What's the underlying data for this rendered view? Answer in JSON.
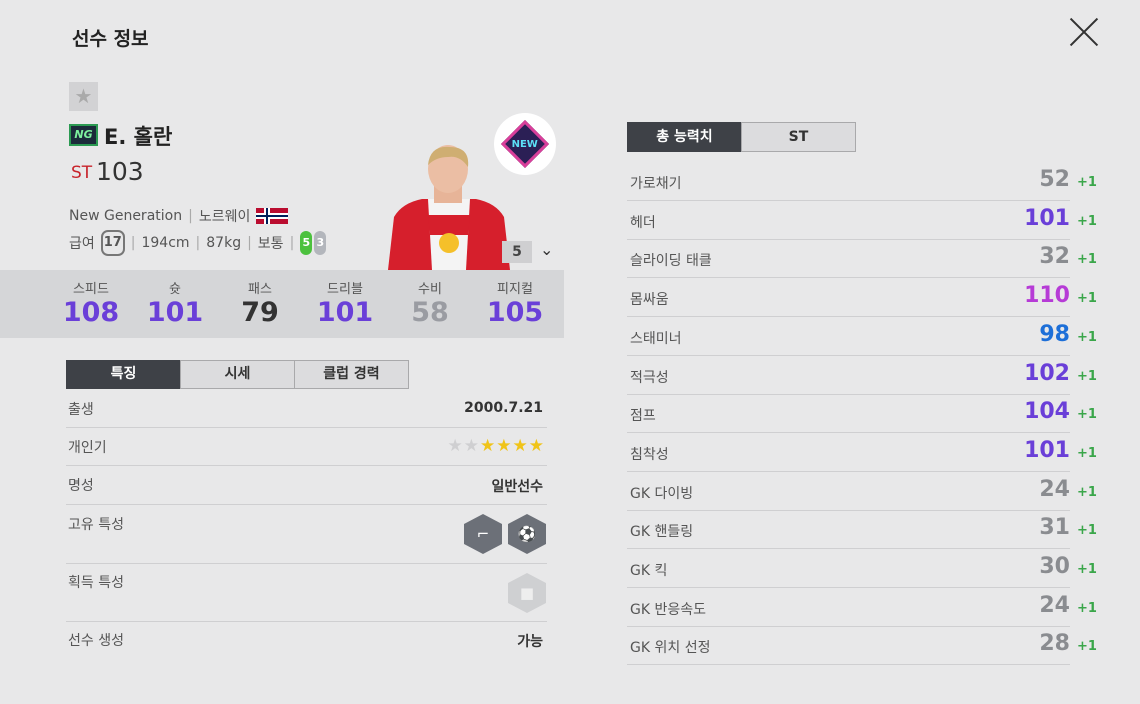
{
  "header": {
    "title": "선수 정보"
  },
  "player": {
    "name": "E. 홀란",
    "season_badge": "NG",
    "position": "ST",
    "overall": "103",
    "season": "New Generation",
    "nation": "노르웨이",
    "salary_label": "급여",
    "salary": "17",
    "height": "194cm",
    "weight": "87kg",
    "body_type": "보통",
    "left_foot": "5",
    "right_foot": "3",
    "enhance_level": "5",
    "club_logo_text": "NEW"
  },
  "summary_stats": [
    {
      "label": "스피드",
      "value": "108",
      "color": "#6a3fd8"
    },
    {
      "label": "슛",
      "value": "101",
      "color": "#6a3fd8"
    },
    {
      "label": "패스",
      "value": "79",
      "color": "#333333"
    },
    {
      "label": "드리블",
      "value": "101",
      "color": "#6a3fd8"
    },
    {
      "label": "수비",
      "value": "58",
      "color": "#9a9ca2"
    },
    {
      "label": "피지컬",
      "value": "105",
      "color": "#6a3fd8"
    }
  ],
  "left_tabs": [
    "특징",
    "시세",
    "클럽 경력"
  ],
  "features": {
    "birth_label": "출생",
    "birth": "2000.7.21",
    "popularity_label": "개인기",
    "popularity_stars": 4,
    "popularity_max": 6,
    "reputation_label": "명성",
    "reputation": "일반선수",
    "unique_trait_label": "고유 특성",
    "acquired_trait_label": "획득 특성",
    "creation_label": "선수 생성",
    "creation": "가능"
  },
  "right_tabs": [
    "총 능력치",
    "ST"
  ],
  "attributes": [
    {
      "label": "가로채기",
      "value": "52",
      "bonus": "+1",
      "color": "#8a8c90"
    },
    {
      "label": "헤더",
      "value": "101",
      "bonus": "+1",
      "color": "#6a3fd8"
    },
    {
      "label": "슬라이딩 태클",
      "value": "32",
      "bonus": "+1",
      "color": "#8a8c90"
    },
    {
      "label": "몸싸움",
      "value": "110",
      "bonus": "+1",
      "color": "#b63bd6"
    },
    {
      "label": "스태미너",
      "value": "98",
      "bonus": "+1",
      "color": "#1d6fd8"
    },
    {
      "label": "적극성",
      "value": "102",
      "bonus": "+1",
      "color": "#6a3fd8"
    },
    {
      "label": "점프",
      "value": "104",
      "bonus": "+1",
      "color": "#6a3fd8"
    },
    {
      "label": "침착성",
      "value": "101",
      "bonus": "+1",
      "color": "#6a3fd8"
    },
    {
      "label": "GK 다이빙",
      "value": "24",
      "bonus": "+1",
      "color": "#8a8c90"
    },
    {
      "label": "GK 핸들링",
      "value": "31",
      "bonus": "+1",
      "color": "#8a8c90"
    },
    {
      "label": "GK 킥",
      "value": "30",
      "bonus": "+1",
      "color": "#8a8c90"
    },
    {
      "label": "GK 반응속도",
      "value": "24",
      "bonus": "+1",
      "color": "#8a8c90"
    },
    {
      "label": "GK 위치 선정",
      "value": "28",
      "bonus": "+1",
      "color": "#8a8c90"
    }
  ]
}
